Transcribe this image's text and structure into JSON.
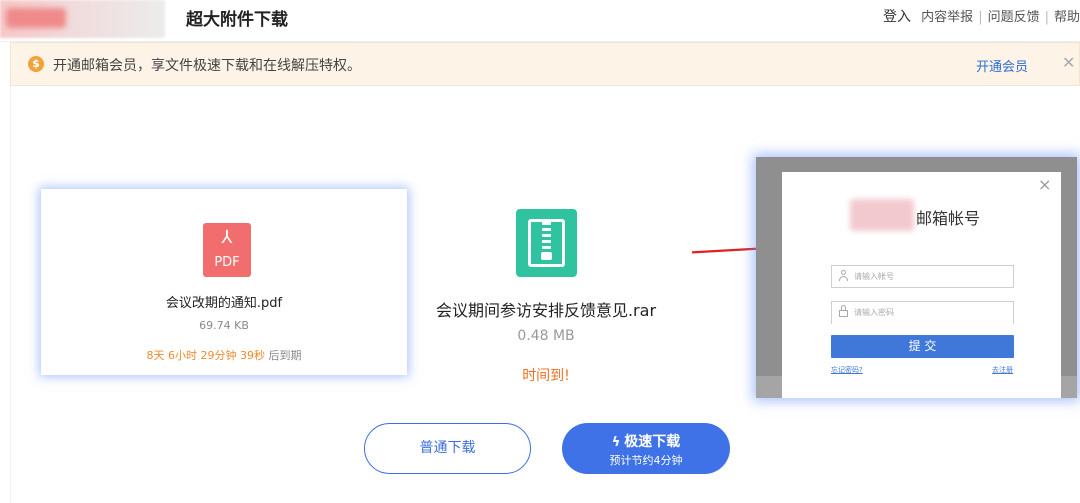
{
  "header": {
    "title": "超大附件下载",
    "login": "登入",
    "links": [
      "内容举报",
      "问题反馈",
      "帮助"
    ],
    "separator": "|"
  },
  "notice": {
    "icon": "coin-icon",
    "coin_glyph": "$",
    "text": "开通邮箱会员，享文件极速下载和在线解压特权。",
    "action": "开通会员",
    "close_glyph": "✕"
  },
  "pdf_file": {
    "icon_label": "PDF",
    "icon_glyph": "⅄",
    "name": "会议改期的通知.pdf",
    "size": "69.74 KB",
    "expire_time": "8天 6小时 29分钟 39秒",
    "expire_suffix": "后到期"
  },
  "rar_file": {
    "name": "会议期间参访安排反馈意见.rar",
    "size": "0.48 MB",
    "status": "时间到!"
  },
  "login_dialog": {
    "title": "邮箱帐号",
    "close_glyph": "×",
    "account_placeholder": "请输入帐号",
    "password_placeholder": "请输入密码",
    "submit": "提 交",
    "forgot": "忘记密码?",
    "register": "去注册"
  },
  "buttons": {
    "normal_download": "普通下载",
    "fast_download": "极速下载",
    "fast_bolt": "ϟ",
    "fast_download_note": "预计节约4分钟"
  },
  "colors": {
    "accent_blue": "#3f72e6",
    "orange": "#f08a2b",
    "pdf_red": "#f26d6d",
    "rar_green": "#30c3a0",
    "arrow_red": "#e02020"
  }
}
